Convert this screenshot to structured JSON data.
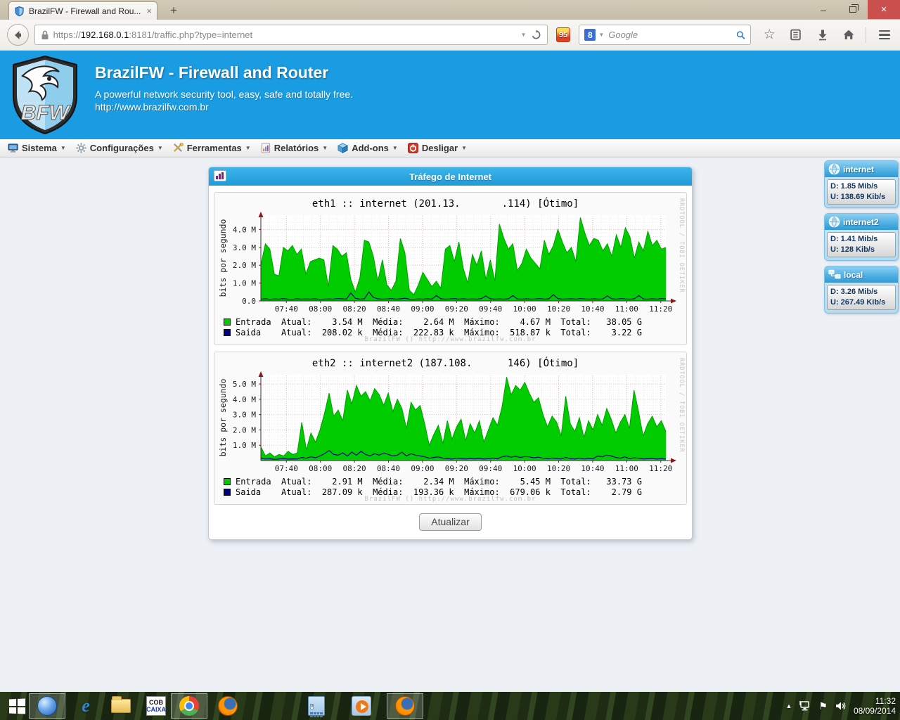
{
  "browser": {
    "tab_title": "BrazilFW - Firewall and Rou...",
    "url_scheme": "https://",
    "url_domain": "192.168.0.1",
    "url_rest": ":8181/traffic.php?type=internet",
    "search_placeholder": "Google",
    "ext_badge": "95"
  },
  "icons": {
    "new_tab": "+",
    "tab_close": "×",
    "minimize": "–",
    "close": "×",
    "url_caret": "▼",
    "search_caret": "▼",
    "google_logo": "8",
    "star": "☆",
    "menu_caret": "▼",
    "tray_arrow": "▲",
    "tray_flag": "⚑",
    "ie_letter": "e",
    "cob_line1": "COB",
    "cob_line2": "CAIXA",
    "calc_display": "0"
  },
  "site_header": {
    "logo_text": "BFW",
    "title": "BrazilFW - Firewall and Router",
    "subtitle": "A powerful network security tool, easy, safe and totally free.",
    "url": "http://www.brazilfw.com.br"
  },
  "menu": {
    "items": [
      {
        "label": "Sistema"
      },
      {
        "label": "Configurações"
      },
      {
        "label": "Ferramentas"
      },
      {
        "label": "Relatórios"
      },
      {
        "label": "Add-ons"
      },
      {
        "label": "Desligar"
      }
    ]
  },
  "panel": {
    "title": "Tráfego de Internet",
    "refresh_label": "Atualizar"
  },
  "chart_data": [
    {
      "type": "area",
      "title": "eth1 :: internet (201.13.       .114) [Ótimo]",
      "ylabel": "bits por segundo",
      "yticks": [
        "0.0",
        "1.0 M",
        "2.0 M",
        "3.0 M",
        "4.0 M"
      ],
      "ytick_values": [
        0,
        1,
        2,
        3,
        4
      ],
      "ymax_render": 4.8,
      "xticks": [
        "07:40",
        "08:00",
        "08:20",
        "08:40",
        "09:00",
        "09:20",
        "09:40",
        "10:00",
        "10:20",
        "10:40",
        "11:00",
        "11:20"
      ],
      "xtick_minutes": [
        460,
        480,
        500,
        520,
        540,
        560,
        580,
        600,
        620,
        640,
        660,
        680
      ],
      "x_range_minutes": [
        445,
        683
      ],
      "grid": true,
      "legend_position": "bottom",
      "series": [
        {
          "name": "Entrada",
          "render": "area",
          "color": "#00cc00",
          "edge": "#00a000",
          "values": [
            2.0,
            3.2,
            2.9,
            1.5,
            1.4,
            3.0,
            2.8,
            3.1,
            2.6,
            2.9,
            1.5,
            2.2,
            2.3,
            2.4,
            2.3,
            0.8,
            3.1,
            2.9,
            2.5,
            2.7,
            1.2,
            0.5,
            1.3,
            3.4,
            3.3,
            2.5,
            1.1,
            2.3,
            0.9,
            0.6,
            1.1,
            3.5,
            2.7,
            0.6,
            0.35,
            0.9,
            1.6,
            1.2,
            0.8,
            1.1,
            0.7,
            2.9,
            3.1,
            2.2,
            3.3,
            1.8,
            1.0,
            2.6,
            2.0,
            2.8,
            1.2,
            2.3,
            1.1,
            4.3,
            3.5,
            2.9,
            3.2,
            1.7,
            2.1,
            2.9,
            2.4,
            2.1,
            1.8,
            3.4,
            2.6,
            3.1,
            4.0,
            3.3,
            2.7,
            3.0,
            2.2,
            4.67,
            3.8,
            3.1,
            3.5,
            3.4,
            2.8,
            3.2,
            2.5,
            3.7,
            3.0,
            4.1,
            3.6,
            2.4,
            3.3,
            2.8,
            3.9,
            3.1,
            3.4,
            2.9,
            3.0
          ]
        },
        {
          "name": "Saida",
          "render": "line",
          "color": "#000080",
          "values": [
            0.1,
            0.12,
            0.09,
            0.11,
            0.1,
            0.13,
            0.1,
            0.09,
            0.12,
            0.1,
            0.11,
            0.1,
            0.12,
            0.09,
            0.1,
            0.11,
            0.1,
            0.13,
            0.12,
            0.1,
            0.45,
            0.15,
            0.1,
            0.12,
            0.5,
            0.2,
            0.12,
            0.1,
            0.11,
            0.13,
            0.1,
            0.12,
            0.15,
            0.1,
            0.09,
            0.11,
            0.1,
            0.12,
            0.1,
            0.3,
            0.12,
            0.1,
            0.11,
            0.13,
            0.1,
            0.12,
            0.1,
            0.11,
            0.1,
            0.13,
            0.28,
            0.12,
            0.1,
            0.11,
            0.1,
            0.12,
            0.3,
            0.11,
            0.1,
            0.12,
            0.1,
            0.11,
            0.13,
            0.1,
            0.12,
            0.35,
            0.13,
            0.1,
            0.11,
            0.12,
            0.1,
            0.13,
            0.11,
            0.1,
            0.12,
            0.1,
            0.11,
            0.28,
            0.12,
            0.1,
            0.13,
            0.11,
            0.1,
            0.12,
            0.3,
            0.11,
            0.1,
            0.12,
            0.1,
            0.13,
            0.11
          ]
        }
      ],
      "legend": [
        {
          "color": "#00cc00",
          "text": "Entrada  Atual:    3.54 M  Média:    2.64 M  Máximo:    4.67 M  Total:   38.05 G"
        },
        {
          "color": "#000080",
          "text": "Saida    Atual:  208.02 k  Média:  222.83 k  Máximo:  518.87 k  Total:    3.22 G"
        }
      ],
      "watermark": "BrazilFW () http://www.brazilfw.com.br",
      "side_label": "RRDTOOL / TOBI OETIKER"
    },
    {
      "type": "area",
      "title": "eth2 :: internet2 (187.108.      146) [Ótimo]",
      "ylabel": "bits por segundo",
      "yticks": [
        "1.0 M",
        "2.0 M",
        "3.0 M",
        "4.0 M",
        "5.0 M"
      ],
      "ytick_values": [
        1,
        2,
        3,
        4,
        5
      ],
      "ymax_render": 5.6,
      "xticks": [
        "07:40",
        "08:00",
        "08:20",
        "08:40",
        "09:00",
        "09:20",
        "09:40",
        "10:00",
        "10:20",
        "10:40",
        "11:00",
        "11:20"
      ],
      "xtick_minutes": [
        460,
        480,
        500,
        520,
        540,
        560,
        580,
        600,
        620,
        640,
        660,
        680
      ],
      "x_range_minutes": [
        445,
        683
      ],
      "grid": true,
      "legend_position": "bottom",
      "series": [
        {
          "name": "Entrada",
          "render": "area",
          "color": "#00cc00",
          "edge": "#00a000",
          "values": [
            0.9,
            0.3,
            0.5,
            0.25,
            0.4,
            0.3,
            0.6,
            0.4,
            0.5,
            2.5,
            0.7,
            1.8,
            1.2,
            2.0,
            3.1,
            4.4,
            2.9,
            3.3,
            2.6,
            4.6,
            3.7,
            4.9,
            4.2,
            4.5,
            3.9,
            4.7,
            4.3,
            3.6,
            4.4,
            3.2,
            4.0,
            3.4,
            2.1,
            3.8,
            3.3,
            3.6,
            2.4,
            1.0,
            1.7,
            2.3,
            1.1,
            2.6,
            1.4,
            2.2,
            2.7,
            1.3,
            2.4,
            1.8,
            2.6,
            1.2,
            2.0,
            2.8,
            2.3,
            3.5,
            5.45,
            4.3,
            4.9,
            4.6,
            5.1,
            4.4,
            3.8,
            4.1,
            3.0,
            2.2,
            2.9,
            2.5,
            1.6,
            4.2,
            2.4,
            1.9,
            2.8,
            1.5,
            2.6,
            2.0,
            3.0,
            2.3,
            3.4,
            2.7,
            1.8,
            2.5,
            3.0,
            2.1,
            4.6,
            3.2,
            1.6,
            2.4,
            2.9,
            2.2,
            2.6,
            1.9
          ]
        },
        {
          "name": "Saida",
          "render": "line",
          "color": "#000080",
          "values": [
            0.15,
            0.1,
            0.12,
            0.08,
            0.1,
            0.12,
            0.09,
            0.11,
            0.1,
            0.2,
            0.15,
            0.25,
            0.18,
            0.3,
            0.45,
            0.65,
            0.4,
            0.35,
            0.5,
            0.3,
            0.55,
            0.35,
            0.6,
            0.4,
            0.3,
            0.45,
            0.35,
            0.5,
            0.4,
            0.3,
            0.35,
            0.55,
            0.3,
            0.45,
            0.35,
            0.3,
            0.25,
            0.15,
            0.2,
            0.25,
            0.15,
            0.12,
            0.1,
            0.15,
            0.12,
            0.1,
            0.13,
            0.11,
            0.14,
            0.1,
            0.12,
            0.15,
            0.11,
            0.25,
            0.3,
            0.22,
            0.28,
            0.2,
            0.26,
            0.24,
            0.18,
            0.22,
            0.15,
            0.12,
            0.16,
            0.12,
            0.1,
            0.2,
            0.12,
            0.1,
            0.15,
            0.1,
            0.13,
            0.11,
            0.3,
            0.25,
            0.35,
            0.3,
            0.2,
            0.15,
            0.25,
            0.12,
            0.18,
            0.15,
            0.1,
            0.12,
            0.14,
            0.1,
            0.12,
            0.1
          ]
        }
      ],
      "legend": [
        {
          "color": "#00cc00",
          "text": "Entrada  Atual:    2.91 M  Média:    2.34 M  Máximo:    5.45 M  Total:   33.73 G"
        },
        {
          "color": "#000080",
          "text": "Saida    Atual:  287.09 k  Média:  193.36 k  Máximo:  679.06 k  Total:    2.79 G"
        }
      ],
      "legend2_note": "",
      "watermark": "BrazilFW () http://www.brazilfw.com.br",
      "side_label": "RRDTOOL / TOBI OETIKER"
    }
  ],
  "sidebar": {
    "widgets": [
      {
        "icon": "globe-icon",
        "label": "internet",
        "down": "D: 1.85 Mib/s",
        "up": "U: 138.69 Kib/s"
      },
      {
        "icon": "globe-icon",
        "label": "internet2",
        "down": "D: 1.41 Mib/s",
        "up": "U: 128 Kib/s"
      },
      {
        "icon": "network-icon",
        "label": "local",
        "down": "D: 3.26 Mib/s",
        "up": "U: 267.49 Kib/s"
      }
    ]
  },
  "taskbar": {
    "clock_time": "11:32",
    "clock_date": "08/09/2014"
  },
  "colors": {
    "header_blue": "#199ce2",
    "panel_blue": "#2aa9e0",
    "rrd_green": "#00cc00",
    "rrd_blue": "#000080",
    "close_red": "#c9504c"
  }
}
